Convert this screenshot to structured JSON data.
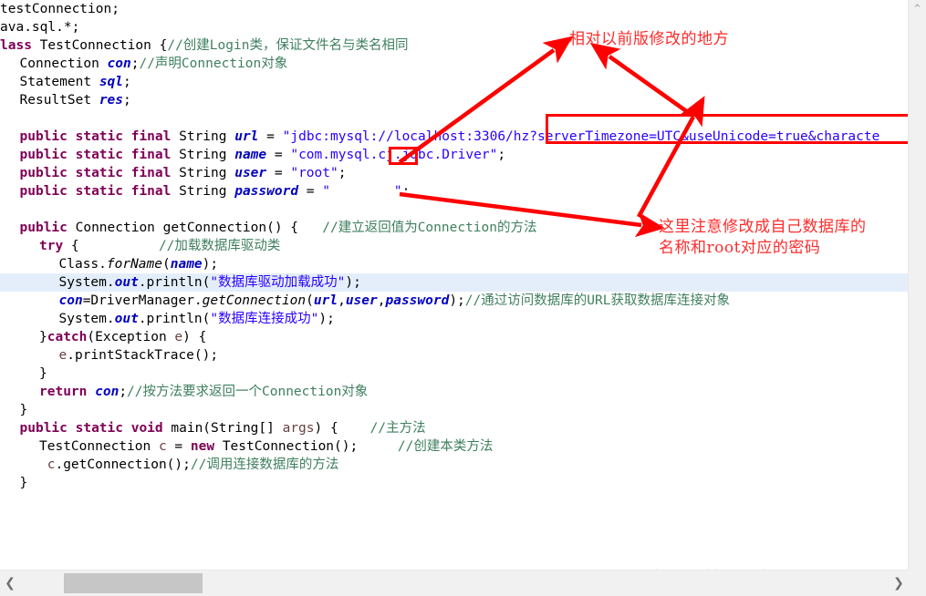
{
  "editor": {
    "language": "java",
    "highlighted_line_index": 15,
    "lines": [
      {
        "indent": 0,
        "tokens": [
          {
            "t": "plain",
            "v": "testConnection;"
          }
        ]
      },
      {
        "indent": 0,
        "tokens": [
          {
            "t": "plain",
            "v": "ava.sql.*;"
          }
        ]
      },
      {
        "indent": 0,
        "tokens": [
          {
            "t": "kw",
            "v": "lass "
          },
          {
            "t": "plain",
            "v": "TestConnection {"
          },
          {
            "t": "cmt",
            "v": "//创建Login类，保证文件名与类名相同"
          }
        ]
      },
      {
        "indent": 1,
        "tokens": [
          {
            "t": "plain",
            "v": "Connection "
          },
          {
            "t": "fld",
            "v": "con"
          },
          {
            "t": "plain",
            "v": ";"
          },
          {
            "t": "cmt",
            "v": "//声明Connection对象"
          }
        ]
      },
      {
        "indent": 1,
        "tokens": [
          {
            "t": "plain",
            "v": "Statement "
          },
          {
            "t": "fld",
            "v": "sql"
          },
          {
            "t": "plain",
            "v": ";"
          }
        ]
      },
      {
        "indent": 1,
        "tokens": [
          {
            "t": "plain",
            "v": "ResultSet "
          },
          {
            "t": "fld",
            "v": "res"
          },
          {
            "t": "plain",
            "v": ";"
          }
        ]
      },
      {
        "indent": 0,
        "tokens": []
      },
      {
        "indent": 1,
        "tokens": [
          {
            "t": "kw",
            "v": "public static final "
          },
          {
            "t": "plain",
            "v": "String "
          },
          {
            "t": "sfld",
            "v": "url"
          },
          {
            "t": "plain",
            "v": " = "
          },
          {
            "t": "str",
            "v": "\"jdbc:mysql://localhost:3306/hz?serverTimezone=UTC&useUnicode=true&characte"
          }
        ]
      },
      {
        "indent": 1,
        "tokens": [
          {
            "t": "kw",
            "v": "public static final "
          },
          {
            "t": "plain",
            "v": "String "
          },
          {
            "t": "sfld",
            "v": "name"
          },
          {
            "t": "plain",
            "v": " = "
          },
          {
            "t": "str",
            "v": "\"com.mysql.cj.jdbc.Driver\""
          },
          {
            "t": "plain",
            "v": ";"
          }
        ]
      },
      {
        "indent": 1,
        "tokens": [
          {
            "t": "kw",
            "v": "public static final "
          },
          {
            "t": "plain",
            "v": "String "
          },
          {
            "t": "sfld",
            "v": "user"
          },
          {
            "t": "plain",
            "v": " = "
          },
          {
            "t": "str",
            "v": "\"root\""
          },
          {
            "t": "plain",
            "v": ";"
          }
        ]
      },
      {
        "indent": 1,
        "tokens": [
          {
            "t": "kw",
            "v": "public static final "
          },
          {
            "t": "plain",
            "v": "String "
          },
          {
            "t": "sfld",
            "v": "password"
          },
          {
            "t": "plain",
            "v": " = "
          },
          {
            "t": "str",
            "v": "\"        \""
          },
          {
            "t": "plain",
            "v": ";"
          }
        ]
      },
      {
        "indent": 0,
        "tokens": []
      },
      {
        "indent": 1,
        "tokens": [
          {
            "t": "kw",
            "v": "public "
          },
          {
            "t": "plain",
            "v": "Connection getConnection() {   "
          },
          {
            "t": "cmt",
            "v": "//建立返回值为Connection的方法"
          }
        ]
      },
      {
        "indent": 2,
        "tokens": [
          {
            "t": "kw",
            "v": "try "
          },
          {
            "t": "plain",
            "v": "{          "
          },
          {
            "t": "cmt",
            "v": "//加载数据库驱动类"
          }
        ]
      },
      {
        "indent": 3,
        "tokens": [
          {
            "t": "plain",
            "v": "Class."
          },
          {
            "t": "mth",
            "v": "forName"
          },
          {
            "t": "plain",
            "v": "("
          },
          {
            "t": "sfld",
            "v": "name"
          },
          {
            "t": "plain",
            "v": ");"
          }
        ]
      },
      {
        "indent": 3,
        "tokens": [
          {
            "t": "plain",
            "v": "System."
          },
          {
            "t": "sfld",
            "v": "out"
          },
          {
            "t": "plain",
            "v": ".println("
          },
          {
            "t": "str",
            "v": "\"数据库驱动加载成功\""
          },
          {
            "t": "plain",
            "v": ");"
          }
        ]
      },
      {
        "indent": 3,
        "tokens": [
          {
            "t": "fld",
            "v": "con"
          },
          {
            "t": "plain",
            "v": "=DriverManager."
          },
          {
            "t": "mth",
            "v": "getConnection"
          },
          {
            "t": "plain",
            "v": "("
          },
          {
            "t": "sfld",
            "v": "url"
          },
          {
            "t": "plain",
            "v": ","
          },
          {
            "t": "sfld",
            "v": "user"
          },
          {
            "t": "plain",
            "v": ","
          },
          {
            "t": "sfld",
            "v": "password"
          },
          {
            "t": "plain",
            "v": ");"
          },
          {
            "t": "cmt",
            "v": "//通过访问数据库的URL获取数据库连接对象"
          }
        ]
      },
      {
        "indent": 3,
        "tokens": [
          {
            "t": "plain",
            "v": "System."
          },
          {
            "t": "sfld",
            "v": "out"
          },
          {
            "t": "plain",
            "v": ".println("
          },
          {
            "t": "str",
            "v": "\"数据库连接成功\""
          },
          {
            "t": "plain",
            "v": ");"
          }
        ]
      },
      {
        "indent": 2,
        "tokens": [
          {
            "t": "plain",
            "v": "}"
          },
          {
            "t": "kw",
            "v": "catch"
          },
          {
            "t": "plain",
            "v": "(Exception "
          },
          {
            "t": "loc",
            "v": "e"
          },
          {
            "t": "plain",
            "v": ") {"
          }
        ]
      },
      {
        "indent": 3,
        "tokens": [
          {
            "t": "loc",
            "v": "e"
          },
          {
            "t": "plain",
            "v": ".printStackTrace();"
          }
        ]
      },
      {
        "indent": 2,
        "tokens": [
          {
            "t": "plain",
            "v": "}"
          }
        ]
      },
      {
        "indent": 2,
        "tokens": [
          {
            "t": "kw",
            "v": "return "
          },
          {
            "t": "fld",
            "v": "con"
          },
          {
            "t": "plain",
            "v": ";"
          },
          {
            "t": "cmt",
            "v": "//按方法要求返回一个Connection对象"
          }
        ]
      },
      {
        "indent": 1,
        "tokens": [
          {
            "t": "plain",
            "v": "}"
          }
        ]
      },
      {
        "indent": 1,
        "tokens": [
          {
            "t": "kw",
            "v": "public static void "
          },
          {
            "t": "plain",
            "v": "main(String[] "
          },
          {
            "t": "loc",
            "v": "args"
          },
          {
            "t": "plain",
            "v": ") {    "
          },
          {
            "t": "cmt",
            "v": "//主方法"
          }
        ]
      },
      {
        "indent": 2,
        "tokens": [
          {
            "t": "plain",
            "v": "TestConnection "
          },
          {
            "t": "loc",
            "v": "c"
          },
          {
            "t": "plain",
            "v": " = "
          },
          {
            "t": "kw",
            "v": "new "
          },
          {
            "t": "plain",
            "v": "TestConnection();     "
          },
          {
            "t": "cmt",
            "v": "//创建本类方法"
          }
        ]
      },
      {
        "indent": 2,
        "tokens": [
          {
            "t": "plain",
            "v": " "
          },
          {
            "t": "loc",
            "v": "c"
          },
          {
            "t": "plain",
            "v": ".getConnection();"
          },
          {
            "t": "cmt",
            "v": "//调用连接数据库的方法"
          }
        ]
      },
      {
        "indent": 1,
        "tokens": [
          {
            "t": "plain",
            "v": "}"
          }
        ]
      }
    ]
  },
  "annotations": {
    "color": "#ff2b2b",
    "box_color": "#ff0000",
    "note_top": "相对以前版修改的地方",
    "note_bottom_line1": "这里注意修改成自己数据库的",
    "note_bottom_line2": "名称和root对应的密码",
    "highlight_box_label": "url-query-string-box",
    "small_box_label": "cj-driver-box"
  },
  "watermark": {
    "text": "https://blog.csdn.net/qq_43466788"
  },
  "scrollbars": {
    "vertical_up": "⌃",
    "vertical_down": "⌄",
    "horizontal_left": "❮",
    "horizontal_right": "❯"
  },
  "colors": {
    "keyword": "#7f0055",
    "string": "#2a00ff",
    "comment": "#3f7f5f",
    "field": "#0000c0",
    "local": "#6a3e3e",
    "highlight_row": "#e4eefb",
    "annotation_red": "#ff2b2b",
    "box_red": "#ff0000"
  }
}
